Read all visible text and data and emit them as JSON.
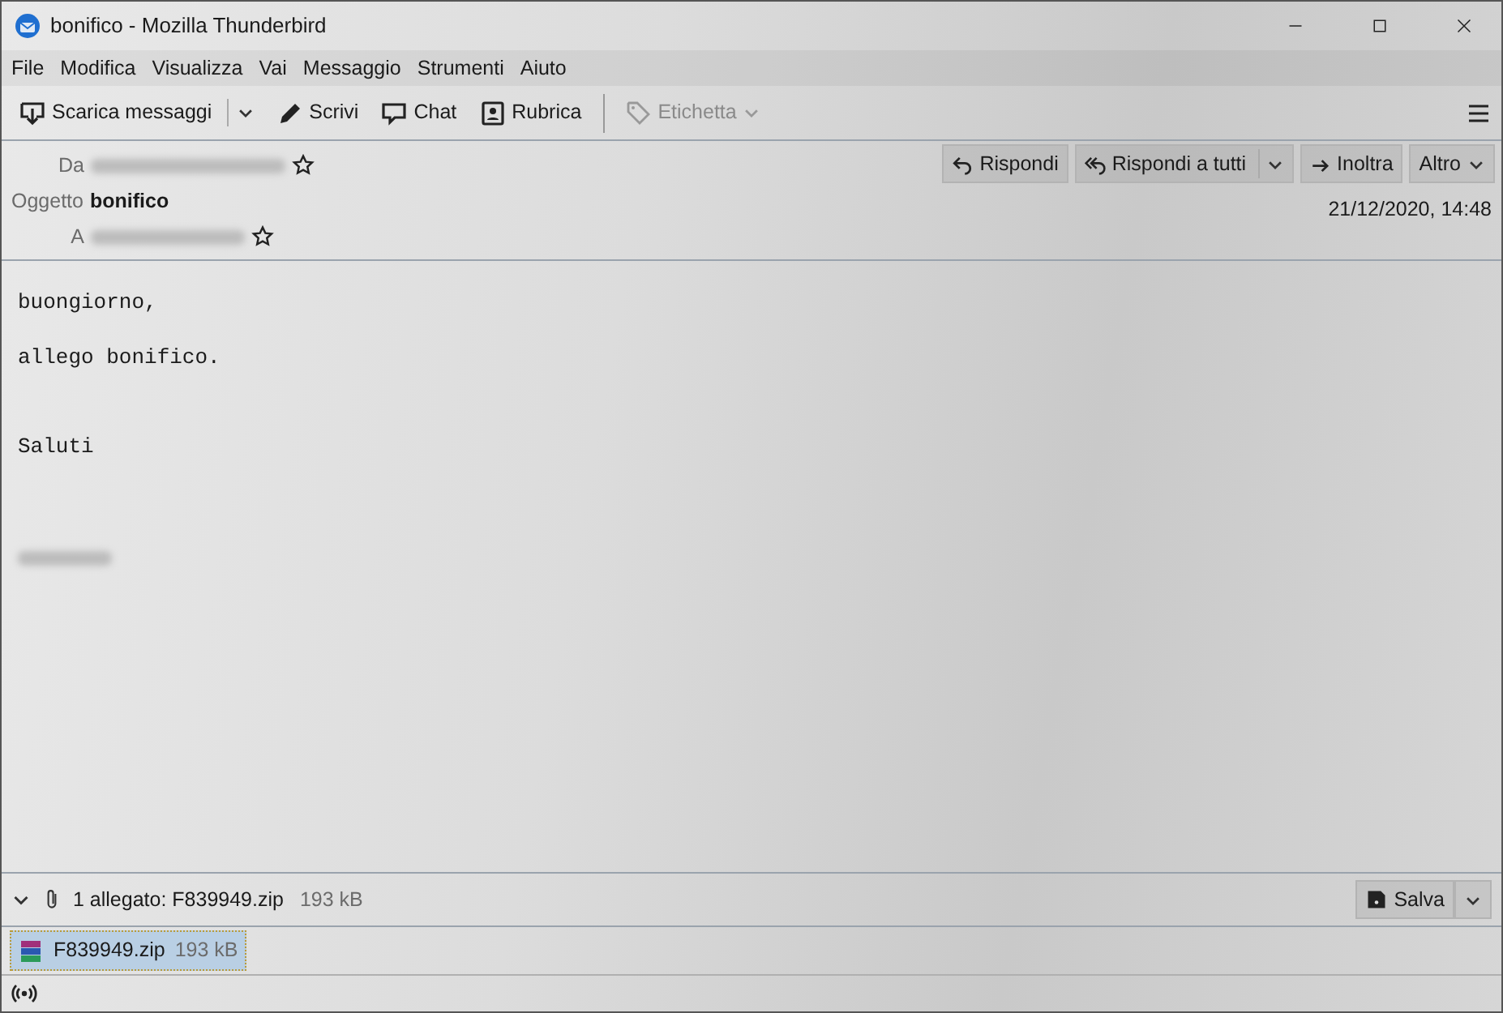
{
  "window": {
    "title": "bonifico - Mozilla Thunderbird"
  },
  "menu": [
    "File",
    "Modifica",
    "Visualizza",
    "Vai",
    "Messaggio",
    "Strumenti",
    "Aiuto"
  ],
  "toolbar": [
    {
      "kind": "download",
      "label": "Scarica messaggi",
      "disabled": false
    },
    {
      "kind": "write",
      "label": "Scrivi",
      "disabled": false
    },
    {
      "kind": "chat",
      "label": "Chat",
      "disabled": false
    },
    {
      "kind": "contacts",
      "label": "Rubrica",
      "disabled": false
    },
    {
      "kind": "tag",
      "label": "Etichetta",
      "disabled": true
    }
  ],
  "header": {
    "from_label": "Da",
    "from_redacted": true,
    "subject_label": "Oggetto",
    "subject": "bonifico",
    "to_label": "A",
    "to_redacted": true,
    "date": "21/12/2020, 14:48",
    "actions": [
      {
        "kind": "reply",
        "label": "Rispondi"
      },
      {
        "kind": "reply_all",
        "label": "Rispondi a tutti"
      },
      {
        "kind": "forward",
        "label": "Inoltra"
      },
      {
        "kind": "more",
        "label": "Altro"
      }
    ]
  },
  "body": {
    "paragraphs": [
      {
        "kind": "text",
        "text": "buongiorno,"
      },
      {
        "kind": "text",
        "text": "allego bonifico."
      },
      {
        "kind": "blank"
      },
      {
        "kind": "text",
        "text": "Saluti"
      }
    ],
    "signature_redacted": true
  },
  "attachment_bar": {
    "expanded": true,
    "summary": "1 allegato: F839949.zip",
    "size": "193 kB",
    "save": "Salva"
  },
  "attachments": [
    {
      "name": "F839949.zip",
      "size": "193 kB",
      "selected": true
    }
  ]
}
